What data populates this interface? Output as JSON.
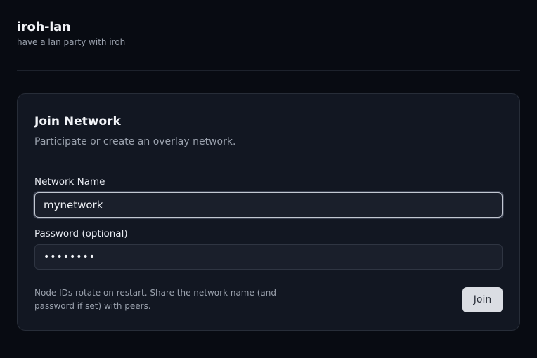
{
  "header": {
    "title": "iroh-lan",
    "subtitle": "have a lan party with iroh"
  },
  "card": {
    "title": "Join Network",
    "description": "Participate or create an overlay network.",
    "network_name": {
      "label": "Network Name",
      "value": "mynetwork"
    },
    "password": {
      "label": "Password (optional)",
      "value": "secret12"
    },
    "note": "Node IDs rotate on restart. Share the network name (and password if set) with peers.",
    "join_label": "Join"
  },
  "colors": {
    "background": "#080b12",
    "card": "#121722",
    "button": "#dadde3"
  }
}
